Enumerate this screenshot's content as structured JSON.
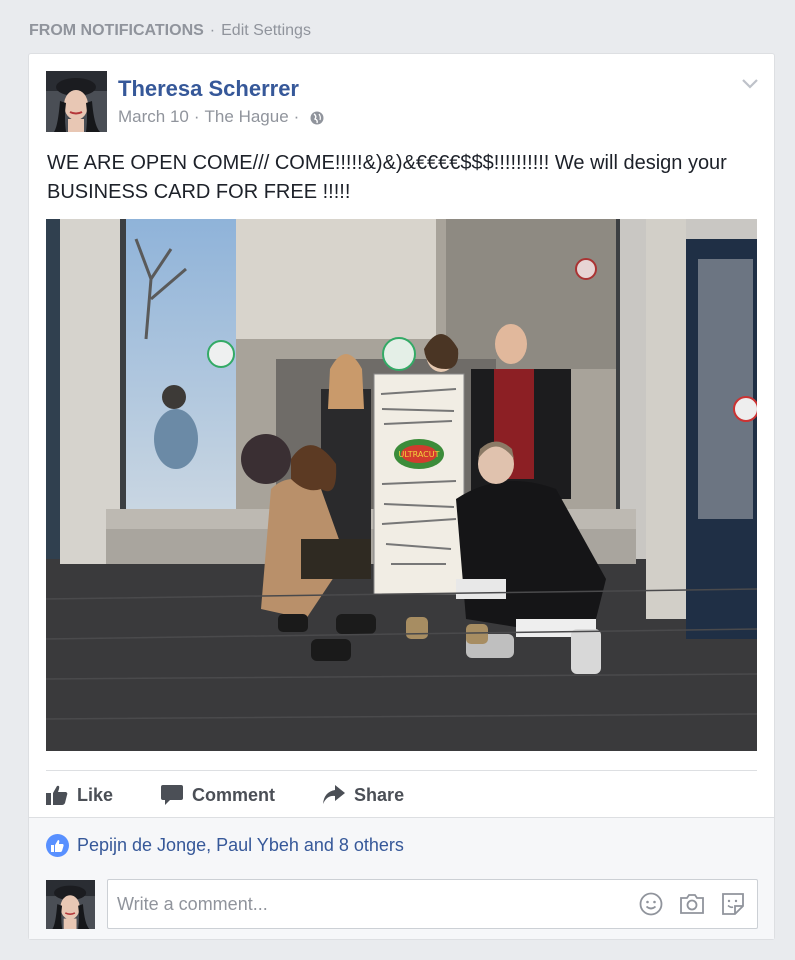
{
  "notification": {
    "source": "FROM NOTIFICATIONS",
    "separator": "·",
    "edit_link": "Edit Settings"
  },
  "post": {
    "author": "Theresa Scherrer",
    "date": "March 10",
    "location": "The Hague",
    "dot": "·",
    "text": "WE ARE OPEN COME/// COME!!!!!&)&)&€€€€$$$!!!!!!!!!! We will design your BUSINESS CARD FOR FREE !!!!!",
    "privacy_icon": "globe-icon",
    "menu_icon": "chevron-down-icon"
  },
  "actions": {
    "like_label": "Like",
    "comment_label": "Comment",
    "share_label": "Share"
  },
  "reactions": {
    "summary": "Pepijn de Jonge, Paul Ybeh and 8 others"
  },
  "comment_input": {
    "placeholder": "Write a comment..."
  },
  "colors": {
    "link_blue": "#365899",
    "muted_gray": "#90949c",
    "like_badge": "#5890ff",
    "page_bg": "#e9ebee"
  }
}
